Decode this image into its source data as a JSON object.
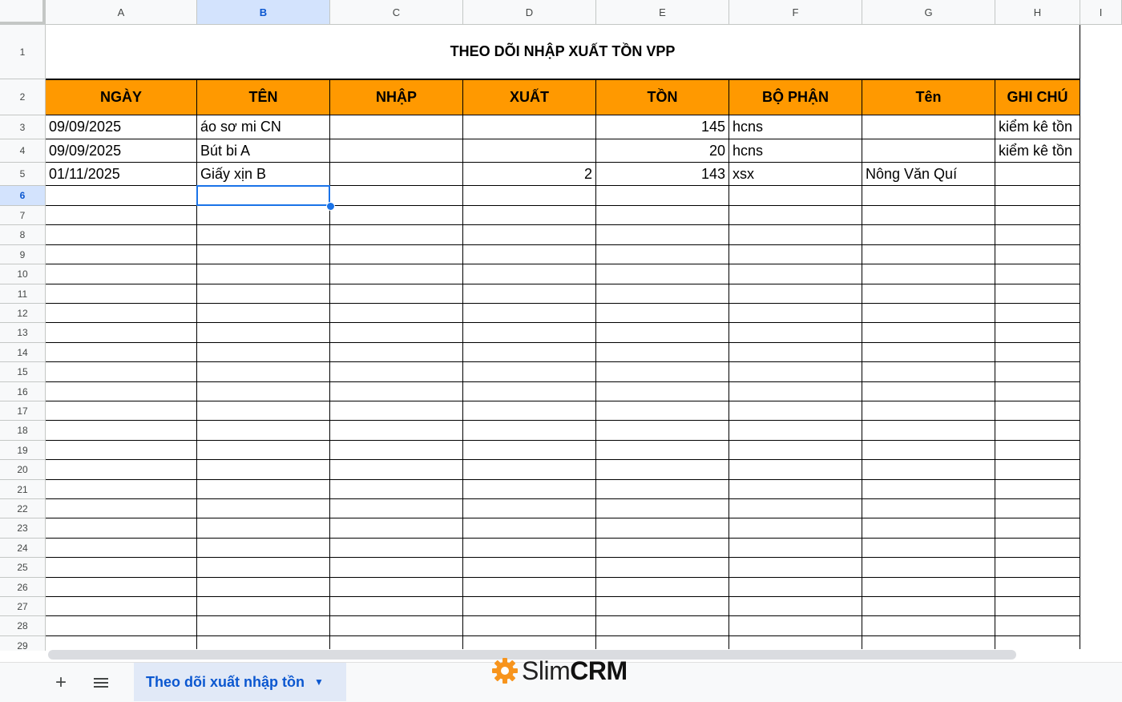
{
  "columns": [
    "A",
    "B",
    "C",
    "D",
    "E",
    "F",
    "G",
    "H",
    "I"
  ],
  "selected_column": "B",
  "rows": [
    "1",
    "2",
    "3",
    "4",
    "5",
    "6",
    "7",
    "8",
    "9",
    "10",
    "11",
    "12",
    "13",
    "14",
    "15",
    "16",
    "17",
    "18",
    "19",
    "20",
    "21",
    "22",
    "23",
    "24",
    "25",
    "26",
    "27",
    "28",
    "29"
  ],
  "selected_row": "6",
  "sheet": {
    "title": "THEO DÕI NHẬP XUẤT TỒN VPP",
    "headers": [
      "NGÀY",
      "TÊN",
      "NHẬP",
      "XUẤT",
      "TỒN",
      "BỘ PHẬN",
      "Tên",
      "GHI CHÚ"
    ],
    "header_color": "#ff9900",
    "data": [
      [
        "09/09/2025",
        "áo sơ mi CN",
        "",
        "",
        "145",
        "hcns",
        "",
        "kiểm kê tồn"
      ],
      [
        "09/09/2025",
        "Bút bi A",
        "",
        "",
        "20",
        "hcns",
        "",
        "kiểm kê tồn"
      ],
      [
        "01/11/2025",
        "Giấy xịn B",
        "",
        "2",
        "143",
        "xsx",
        "Nông Văn Quí",
        ""
      ]
    ]
  },
  "tabbar": {
    "add_sheet_icon": "plus-icon",
    "all_sheets_icon": "menu-icon",
    "sheet_tab_label": "Theo dõi xuất nhập tồn",
    "dropdown_icon": "caret-down-icon"
  },
  "watermark": {
    "brand_light": "Slim",
    "brand_bold": "CRM",
    "icon": "gear-icon",
    "accent": "#f7941d"
  },
  "selection_color": "#1a73e8"
}
